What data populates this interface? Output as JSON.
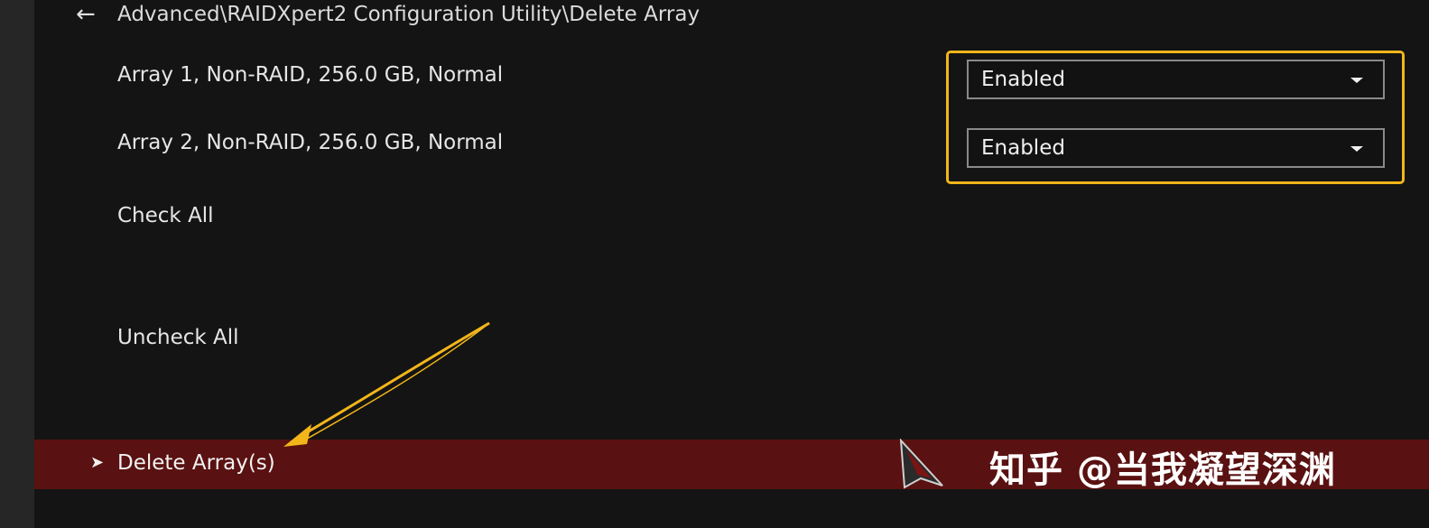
{
  "breadcrumb": {
    "path": "Advanced\\RAIDXpert2 Configuration Utility\\Delete Array",
    "back_icon": "back-arrow-icon"
  },
  "arrays": [
    {
      "label": "Array 1, Non-RAID, 256.0 GB, Normal",
      "value": "Enabled"
    },
    {
      "label": "Array 2, Non-RAID, 256.0 GB, Normal",
      "value": "Enabled"
    }
  ],
  "actions": {
    "check_all": "Check All",
    "uncheck_all": "Uncheck All",
    "delete_arrays": "Delete Array(s)"
  },
  "watermark": "知乎 @当我凝望深渊",
  "colors": {
    "highlight": "#f3b61a",
    "selected_bar": "#5a1111",
    "background": "#141414"
  }
}
